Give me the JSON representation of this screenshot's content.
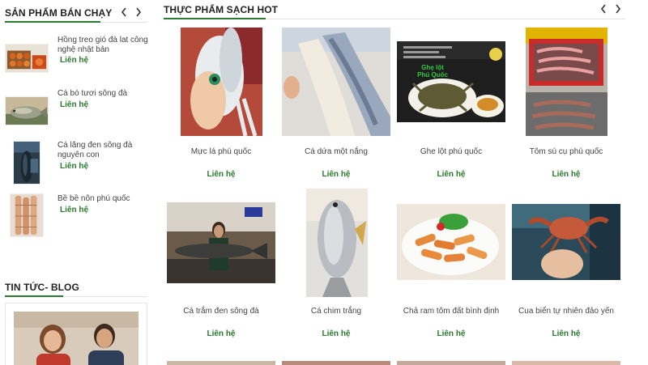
{
  "sidebar": {
    "bestsellers_title": "SẢN PHẨM BÁN CHẠY",
    "items": [
      {
        "name": "Hồng treo gió đà lat công nghệ nhật bản",
        "price": "Liên hệ",
        "icon": "persimmon-photo"
      },
      {
        "name": "Cá bò tươi sông đà",
        "price": "Liên hệ",
        "icon": "fish-photo"
      },
      {
        "name": "Cá lăng đen sông đà nguyên con",
        "price": "Liên hệ",
        "icon": "catfish-photo"
      },
      {
        "name": "Bề bề nõn phú quốc",
        "price": "Liên hệ",
        "icon": "mantis-shrimp-photo"
      }
    ],
    "blog_title": "TIN TỨC- BLOG"
  },
  "main": {
    "title": "THỰC PHẨM SẠCH HOT",
    "products": [
      {
        "name": "Mực lá phú quốc",
        "price": "Liên hệ"
      },
      {
        "name": "Cá dứa một nắng",
        "price": "Liên hệ"
      },
      {
        "name": "Ghe lột phú quốc",
        "price": "Liên hệ"
      },
      {
        "name": "Tôm sú cụ phú quốc",
        "price": "Liên hệ"
      },
      {
        "name": "Cá trắm đen sông đà",
        "price": "Liên hệ"
      },
      {
        "name": "Cá chim trắng",
        "price": "Liên hệ"
      },
      {
        "name": "Chả ram tôm đất bình định",
        "price": "Liên hệ"
      },
      {
        "name": "Cua biển tự nhiên đảo yến",
        "price": "Liên hệ"
      }
    ],
    "ghe_label_line1": "Ghẹ lột",
    "ghe_label_line2": "Phú Quốc"
  },
  "colors": {
    "accent_green": "#2a7a2e",
    "title_dark": "#222222"
  }
}
